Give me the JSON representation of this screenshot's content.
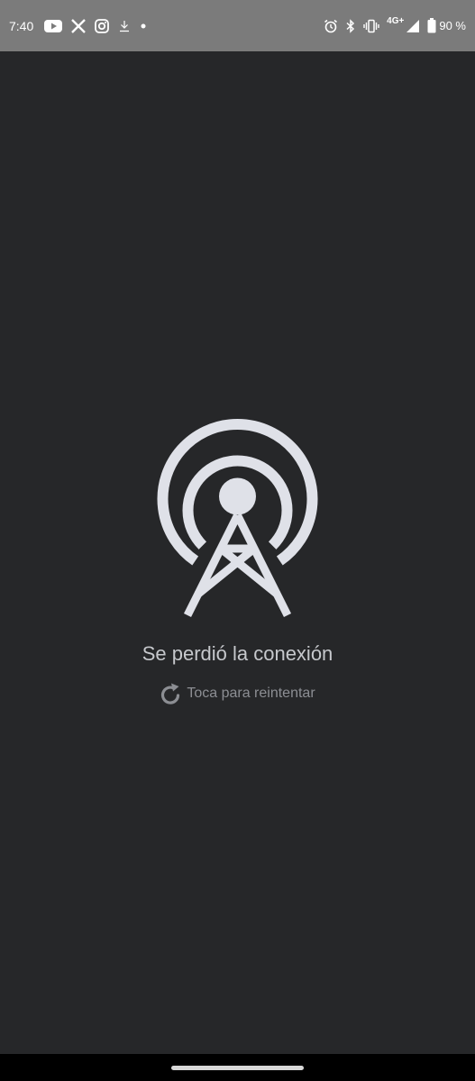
{
  "status_bar": {
    "time": "7:40",
    "network": "4G+",
    "battery": "90 %",
    "left_icons": [
      "youtube-icon",
      "x-icon",
      "instagram-icon",
      "download-icon",
      "dot-icon"
    ],
    "right_icons": [
      "alarm-icon",
      "bluetooth-icon",
      "vibrate-icon",
      "signal-icon",
      "battery-icon"
    ],
    "background": "#7b7b7b"
  },
  "error": {
    "icon": "broadcast-tower-icon",
    "title": "Se perdió la conexión",
    "retry_label": "Toca para reintentar",
    "retry_icon": "refresh-icon"
  },
  "colors": {
    "background": "#262729",
    "icon": "#dfe1e8",
    "title_text": "#c6c8cc",
    "retry_text": "#8c8e93"
  }
}
